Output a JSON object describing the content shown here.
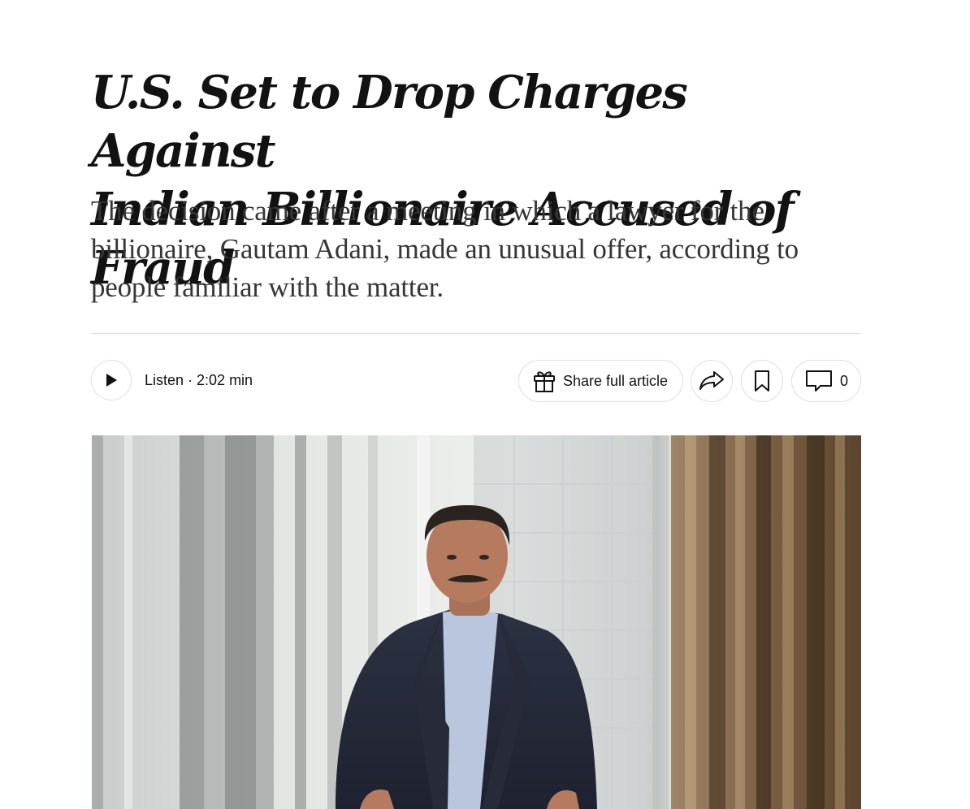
{
  "article": {
    "headline_line1": "U.S. Set to Drop Charges Against",
    "headline_line2": "Indian Billionaire Accused of Fraud",
    "summary": "The decision came after a meeting in which a lawyer for the billionaire, Gautam Adani, made an unusual offer, according to people familiar with the matter."
  },
  "toolbar": {
    "play_icon": "play-icon",
    "listen_label": "Listen · 2:02 min",
    "share_full_article_icon": "gift-icon",
    "share_full_article_label": "Share full article",
    "share_icon": "share-arrow-icon",
    "save_icon": "bookmark-icon",
    "comments_icon": "comment-bubble-icon",
    "comments_count": "0"
  },
  "colors": {
    "text": "#121212",
    "summary_text": "#363636",
    "border": "#dfdfdf"
  }
}
